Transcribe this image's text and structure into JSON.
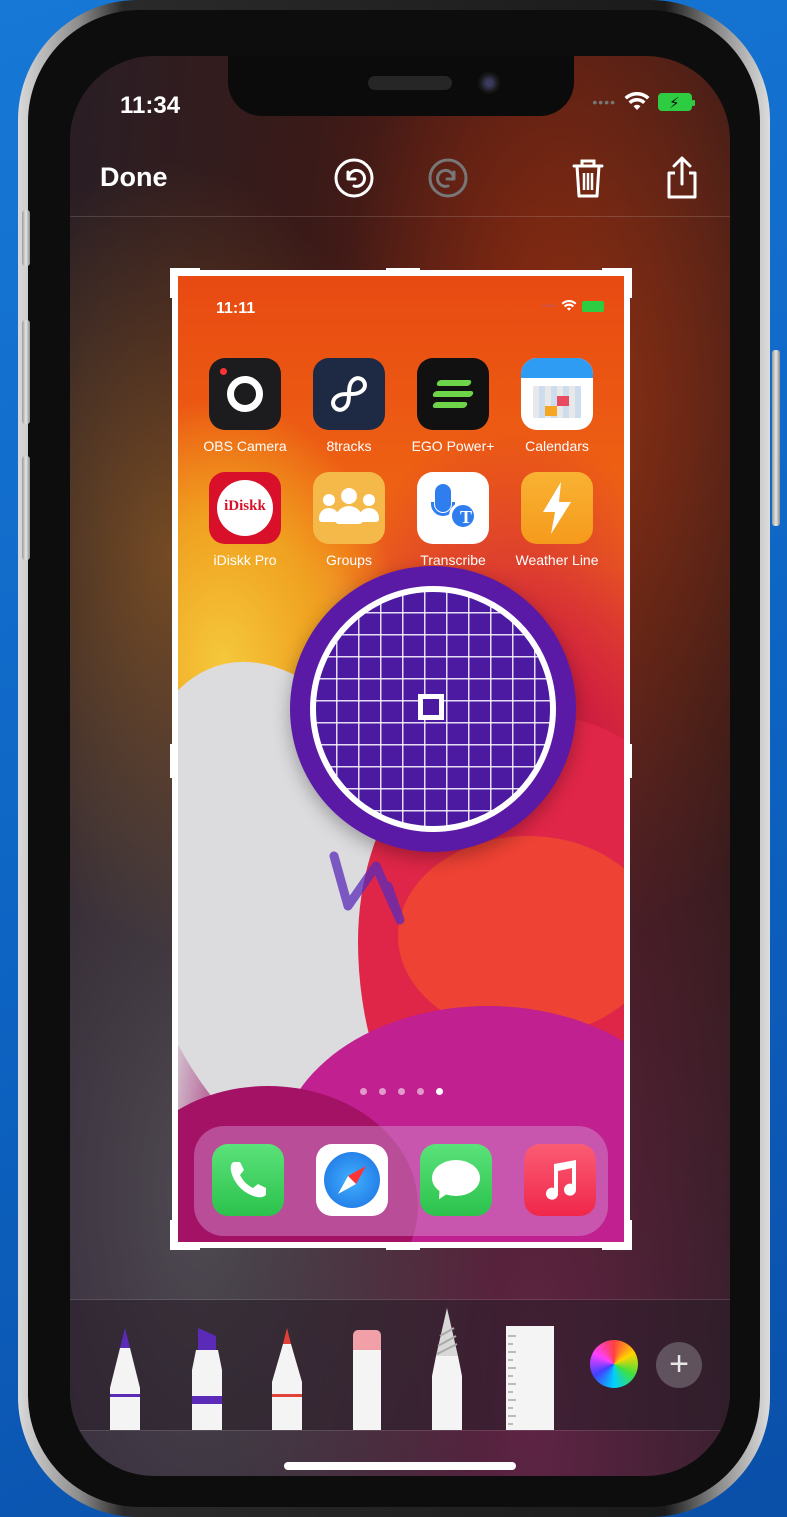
{
  "status_bar": {
    "time": "11:34"
  },
  "toolbar": {
    "done_label": "Done",
    "undo_icon": "undo-icon",
    "redo_icon": "redo-icon",
    "trash_icon": "trash-icon",
    "share_icon": "share-icon"
  },
  "screenshot": {
    "time": "11:11",
    "apps": [
      {
        "label": "OBS Camera",
        "icon": "obs-camera-icon",
        "color": "#1c1c1e"
      },
      {
        "label": "8tracks",
        "icon": "8tracks-icon",
        "color": "#1e2a44"
      },
      {
        "label": "EGO Power+",
        "icon": "ego-power-icon",
        "color": "#111111"
      },
      {
        "label": "Calendars",
        "icon": "calendars-icon",
        "color": "#ffffff"
      },
      {
        "label": "iDiskk Pro",
        "icon": "idiskk-pro-icon",
        "color": "#d8102a",
        "badge_text": "iDiskk"
      },
      {
        "label": "Groups",
        "icon": "groups-icon",
        "color": "#f5b94a"
      },
      {
        "label": "Transcribe",
        "icon": "transcribe-icon",
        "color": "#ffffff",
        "badge_text": "T"
      },
      {
        "label": "Weather Line",
        "icon": "weather-line-icon",
        "color": "#f7a623"
      }
    ],
    "dock": [
      {
        "icon": "phone-icon",
        "color": "#2fd158"
      },
      {
        "icon": "safari-icon",
        "color": "#ffffff"
      },
      {
        "icon": "messages-icon",
        "color": "#2fd158"
      },
      {
        "icon": "music-icon",
        "color": "#f5344f"
      }
    ],
    "page_count": 5,
    "active_page": 5
  },
  "loupe": {
    "color": "#5b1aa6"
  },
  "tools": {
    "items": [
      {
        "name": "pen-tool",
        "tip_color": "#5b2bb8"
      },
      {
        "name": "marker-tool",
        "tip_color": "#5b2bb8"
      },
      {
        "name": "pencil-tool",
        "tip_color": "#e0423a"
      },
      {
        "name": "eraser-tool",
        "tip_color": "#f2a0a8"
      },
      {
        "name": "lasso-tool",
        "tip_color": "#cfcfcf"
      },
      {
        "name": "ruler-tool",
        "tip_color": "#ffffff"
      }
    ],
    "add_label": "+"
  }
}
